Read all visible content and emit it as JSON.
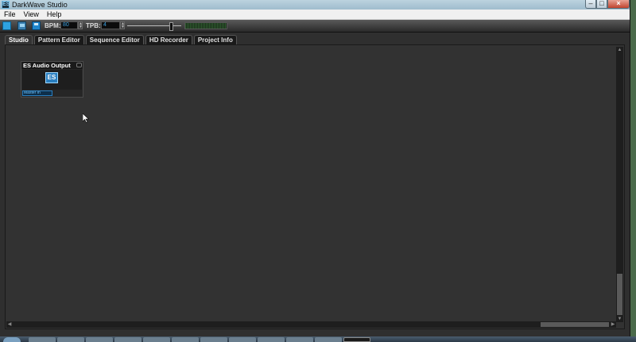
{
  "window": {
    "title": "DarkWave Studio",
    "app_icon_text": "ES",
    "controls": {
      "minimize": "–",
      "maximize": "□",
      "close": "×"
    }
  },
  "menu": {
    "items": [
      "File",
      "View",
      "Help"
    ]
  },
  "toolbar": {
    "bpm_label": "BPM:",
    "bpm_value": "80",
    "tpb_label": "TPB:",
    "tpb_value": "4"
  },
  "tabs": [
    "Studio",
    "Pattern Editor",
    "Sequence Editor",
    "HD Recorder",
    "Project Info"
  ],
  "active_tab": "Studio",
  "module": {
    "title": "ES Audio Output",
    "logo_text": "ES",
    "port_label": "Master In"
  },
  "colors": {
    "accent": "#2a7fc0",
    "workspace": "#323232",
    "titlebar": "#bcd3df"
  }
}
